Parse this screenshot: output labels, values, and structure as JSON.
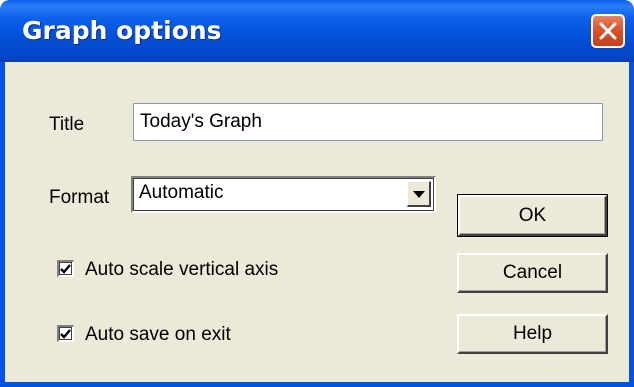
{
  "window": {
    "title": "Graph options"
  },
  "fields": {
    "title_label": "Title",
    "title_value": "Today's Graph",
    "format_label": "Format",
    "format_value": "Automatic"
  },
  "checkboxes": [
    {
      "label": "Auto scale vertical axis",
      "checked": true
    },
    {
      "label": "Auto save on exit",
      "checked": true
    }
  ],
  "buttons": {
    "ok_label": "OK",
    "cancel_label": "Cancel",
    "help_label": "Help"
  },
  "colors": {
    "titlebar": "#0054e3",
    "client_bg": "#ece9d8",
    "close_button": "#d8532c"
  },
  "icons": {
    "close": "close-icon",
    "dropdown": "chevron-down-icon",
    "check": "checkmark-icon"
  }
}
